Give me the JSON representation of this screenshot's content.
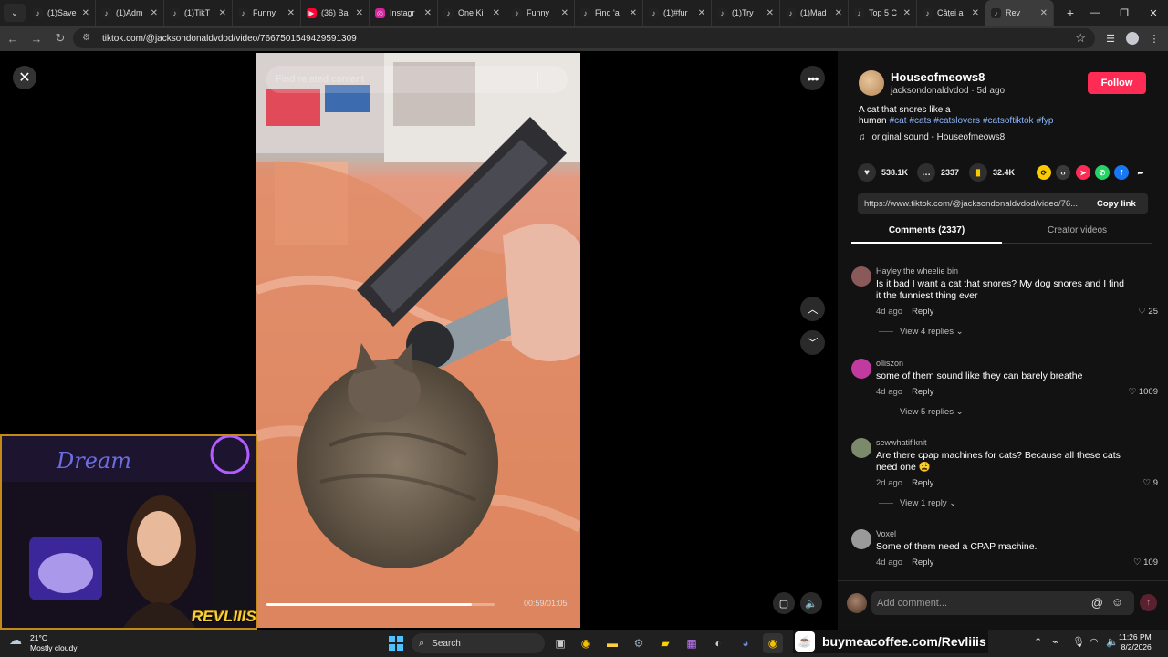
{
  "browser": {
    "tabs": [
      {
        "label": "(1)Save",
        "icon": "tiktok-icon",
        "color": "#222"
      },
      {
        "label": "(1)Adm",
        "icon": "tiktok-icon",
        "color": "#222"
      },
      {
        "label": "(1)TikT",
        "icon": "tiktok-icon",
        "color": "#222"
      },
      {
        "label": "Funny",
        "icon": "tiktok-icon",
        "color": "#222"
      },
      {
        "label": "(36) Ba",
        "icon": "youtube-icon",
        "color": "#ff0033"
      },
      {
        "label": "Instagr",
        "icon": "instagram-icon",
        "color": "#d6249f"
      },
      {
        "label": "One Ki",
        "icon": "tiktok-icon",
        "color": "#222"
      },
      {
        "label": "Funny",
        "icon": "tiktok-icon",
        "color": "#222"
      },
      {
        "label": "Find 'a",
        "icon": "tiktok-icon",
        "color": "#222"
      },
      {
        "label": "(1)#fur",
        "icon": "tiktok-icon",
        "color": "#222"
      },
      {
        "label": "(1)Try",
        "icon": "tiktok-icon",
        "color": "#222"
      },
      {
        "label": "(1)Mad",
        "icon": "tiktok-icon",
        "color": "#222"
      },
      {
        "label": "Top 5 C",
        "icon": "tiktok-icon",
        "color": "#222"
      },
      {
        "label": "Câței a",
        "icon": "tiktok-icon",
        "color": "#222"
      },
      {
        "label": "Rev",
        "icon": "tiktok-icon",
        "color": "#222",
        "active": true
      }
    ],
    "url": "tiktok.com/@jacksondonaldvdod/video/7667501549429591309"
  },
  "video": {
    "search_placeholder": "Find related content",
    "time": "00:59/01:05",
    "progress": 0.9
  },
  "webcam": {
    "brand": "REVLIIIS"
  },
  "post": {
    "author": "Houseofmeows8",
    "handle": "jacksondonaldvdod",
    "age": "5d ago",
    "follow_label": "Follow",
    "caption_text": "A cat that snores like a human",
    "hashtags": [
      "#cat",
      "#cats",
      "#catslovers",
      "#catsoftiktok",
      "#fyp"
    ],
    "sound": "original sound - Houseofmeows8",
    "likes": "538.1K",
    "comments": "2337",
    "saves": "32.4K",
    "link": "https://www.tiktok.com/@jacksondonaldvdod/video/76...",
    "copy_label": "Copy link",
    "tab_comments": "Comments (2337)",
    "tab_creator": "Creator videos"
  },
  "comments": [
    {
      "name": "Hayley the wheelie bin",
      "text": "Is it bad I want a cat that snores? My dog snores and I find it the funniest thing ever",
      "age": "4d ago",
      "reply": "Reply",
      "likes": "25",
      "view": "View 4 replies",
      "avatar_color": "#8a5a5a"
    },
    {
      "name": "olliszon",
      "text": "some of them sound like they can barely breathe",
      "age": "4d ago",
      "reply": "Reply",
      "likes": "1009",
      "view": "View 5 replies",
      "avatar_color": "#c03aa0"
    },
    {
      "name": "sewwhatifiknit",
      "text": "Are there cpap machines for cats? Because all these cats need one 😩",
      "age": "2d ago",
      "reply": "Reply",
      "likes": "9",
      "view": "View 1 reply",
      "avatar_color": "#7a8a6a"
    },
    {
      "name": "Voxel",
      "text": "Some of them need a CPAP machine.",
      "age": "4d ago",
      "reply": "Reply",
      "likes": "109",
      "view": "",
      "avatar_color": "#9a9a9a"
    }
  ],
  "comment_input": {
    "placeholder": "Add comment..."
  },
  "taskbar": {
    "temp": "21°C",
    "weather": "Mostly cloudy",
    "search": "Search",
    "promo": "buymeacoffee.com/Revliiis",
    "time": "11:26 PM",
    "date": "8/2/2026"
  }
}
